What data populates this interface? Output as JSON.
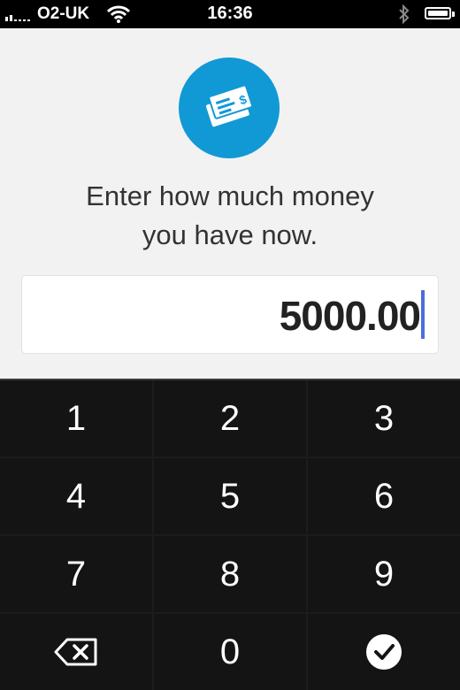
{
  "status_bar": {
    "carrier": "O2-UK",
    "time": "16:36",
    "icons": [
      "signal-icon",
      "wifi-icon",
      "bluetooth-icon",
      "battery-icon"
    ]
  },
  "header": {
    "logo_icon": "money-cheque-icon",
    "accent_color": "#1199d6"
  },
  "prompt": {
    "line1": "Enter how much money",
    "line2": "you have now."
  },
  "amount_input": {
    "value": "5000.00"
  },
  "keypad": {
    "keys": [
      "1",
      "2",
      "3",
      "4",
      "5",
      "6",
      "7",
      "8",
      "9",
      "backspace",
      "0",
      "confirm"
    ],
    "labels": {
      "k1": "1",
      "k2": "2",
      "k3": "3",
      "k4": "4",
      "k5": "5",
      "k6": "6",
      "k7": "7",
      "k8": "8",
      "k9": "9",
      "k0": "0"
    },
    "backspace_icon": "backspace-icon",
    "confirm_icon": "checkmark-icon"
  }
}
